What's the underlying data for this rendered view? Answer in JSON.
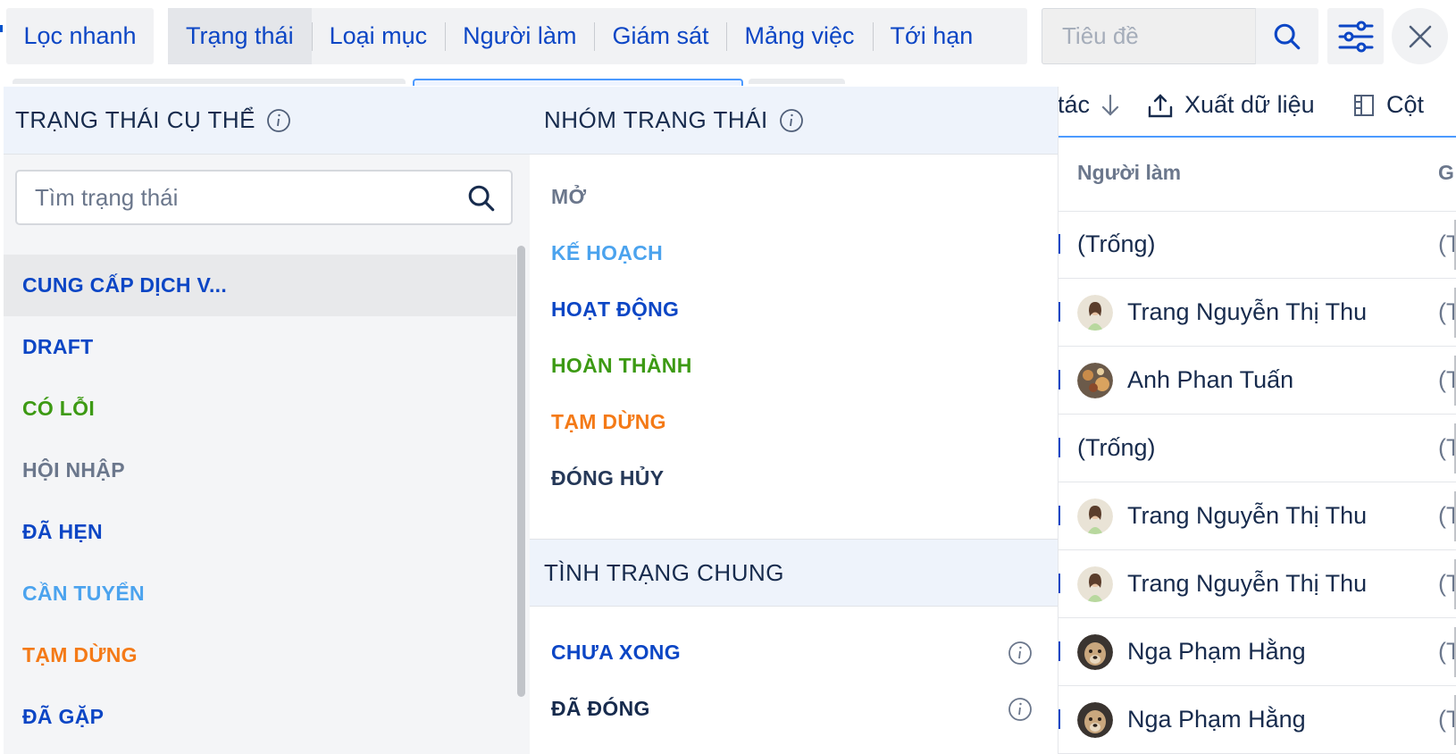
{
  "filters": {
    "quick_filter": "Lọc nhanh",
    "tabs": [
      {
        "label": "Trạng thái",
        "active": true
      },
      {
        "label": "Loại mục",
        "active": false
      },
      {
        "label": "Người làm",
        "active": false
      },
      {
        "label": "Giám sát",
        "active": false
      },
      {
        "label": "Mảng việc",
        "active": false
      },
      {
        "label": "Tới hạn",
        "active": false
      }
    ],
    "search_placeholder": "Tiêu đề",
    "search_icon": "search-icon",
    "settings_icon": "sliders-icon",
    "close_icon": "close-icon"
  },
  "specific_status": {
    "title": "TRẠNG THÁI CỤ THỂ",
    "search_placeholder": "Tìm trạng thái",
    "items": [
      {
        "label": "CUNG CẤP DỊCH V...",
        "color": "#0c46c5",
        "highlighted": true
      },
      {
        "label": "DRAFT",
        "color": "#0c46c5"
      },
      {
        "label": "CÓ LỖI",
        "color": "#3d9a14"
      },
      {
        "label": "HỘI NHẬP",
        "color": "#6b778c"
      },
      {
        "label": "ĐÃ HẸN",
        "color": "#0c46c5"
      },
      {
        "label": "CẦN TUYỂN",
        "color": "#4ba3ee"
      },
      {
        "label": "TẠM DỪNG",
        "color": "#f47a17"
      },
      {
        "label": "ĐÃ GẶP",
        "color": "#0c46c5"
      }
    ]
  },
  "status_group": {
    "title": "NHÓM TRẠNG THÁI",
    "items": [
      {
        "label": "MỞ",
        "color": "#6b778c"
      },
      {
        "label": "KẾ HOẠCH",
        "color": "#4ba3ee"
      },
      {
        "label": "HOẠT ĐỘNG",
        "color": "#0c46c5"
      },
      {
        "label": "HOÀN THÀNH",
        "color": "#3d9a14"
      },
      {
        "label": "TẠM DỪNG",
        "color": "#f47a17"
      },
      {
        "label": "ĐÓNG HỦY",
        "color": "#253858"
      }
    ]
  },
  "general_status": {
    "title": "TÌNH TRẠNG CHUNG",
    "items": [
      {
        "label": "CHƯA XONG",
        "color": "#0c46c5"
      },
      {
        "label": "ĐÃ ĐÓNG",
        "color": "#172b4d"
      }
    ]
  },
  "toolbar": {
    "sort_label": "tác",
    "export_label": "Xuất dữ liệu",
    "columns_label": "Cột"
  },
  "table": {
    "header_assignee": "Người làm",
    "header_next": "G",
    "rows": [
      {
        "assignee": "(Trống)",
        "avatar": null,
        "next": "(T"
      },
      {
        "assignee": "Trang Nguyễn Thị Thu",
        "avatar": "woman-avatar",
        "next": "(T"
      },
      {
        "assignee": "Anh Phan Tuấn",
        "avatar": "man-avatar",
        "next": "(T"
      },
      {
        "assignee": "(Trống)",
        "avatar": null,
        "next": "(T"
      },
      {
        "assignee": "Trang Nguyễn Thị Thu",
        "avatar": "woman-avatar",
        "next": "(T"
      },
      {
        "assignee": "Trang Nguyễn Thị Thu",
        "avatar": "woman-avatar",
        "next": "(T"
      },
      {
        "assignee": "Nga Phạm Hằng",
        "avatar": "dog-avatar",
        "next": "(T"
      },
      {
        "assignee": "Nga Phạm Hằng",
        "avatar": "dog-avatar",
        "next": "(T"
      }
    ]
  }
}
